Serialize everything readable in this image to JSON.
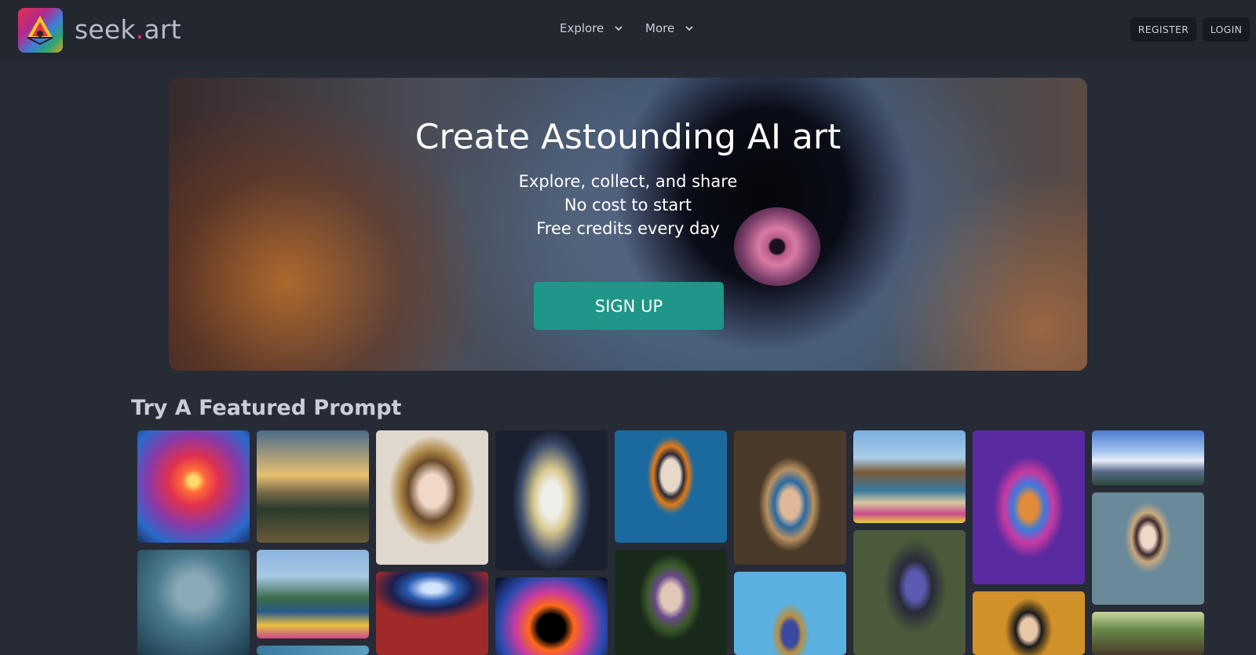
{
  "header": {
    "brand_name": "seek",
    "brand_dot": ".",
    "brand_tld": "art",
    "nav": [
      {
        "label": "Explore",
        "icon": "chevron-down-icon"
      },
      {
        "label": "More",
        "icon": "chevron-down-icon"
      }
    ],
    "register_label": "REGISTER",
    "login_label": "LOGIN"
  },
  "hero": {
    "title": "Create Astounding AI art",
    "lines": [
      "Explore, collect, and share",
      "No cost to start",
      "Free credits every day"
    ],
    "cta_label": "SIGN UP"
  },
  "featured": {
    "title": "Try A Featured Prompt",
    "images": [
      "sunset-astronaut",
      "landscape-lake",
      "butterfly-girl",
      "golden-angel",
      "portrait-orange-swirl",
      "crowned-woman",
      "coastal-rocks",
      "psychedelic-woman",
      "snowy-mountains",
      "bubble-man",
      "coastal-cliffs",
      "blue-vortex",
      "fiery-black-hole",
      "forest-dryad",
      "owl",
      "fairy-sitting",
      "short-hair-woman",
      "anime-woman",
      "cabin"
    ]
  },
  "colors": {
    "background": "#262b36",
    "header": "#222730",
    "accent": "#1e9688",
    "brand_dot": "#e0387a"
  }
}
